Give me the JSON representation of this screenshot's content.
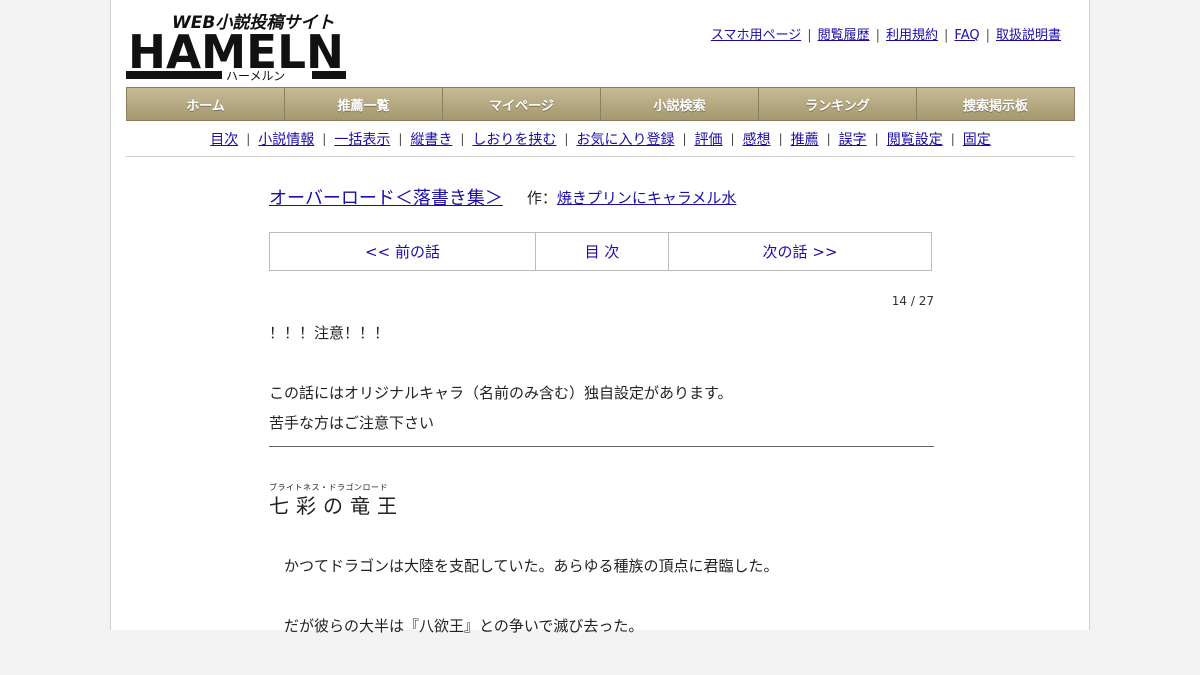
{
  "logo": {
    "tagline": "WEB小説投稿サイト",
    "name": "HAMELN",
    "kana": "ハーメルン"
  },
  "top_links": [
    "スマホ用ページ",
    "閲覧履歴",
    "利用規約",
    "FAQ",
    "取扱説明書"
  ],
  "main_nav": [
    "ホーム",
    "推薦一覧",
    "マイページ",
    "小説検索",
    "ランキング",
    "捜索掲示板"
  ],
  "sub_nav": [
    "目次",
    "小説情報",
    "一括表示",
    "縦書き",
    "しおりを挟む",
    "お気に入り登録",
    "評価",
    "感想",
    "推薦",
    "誤字",
    "閲覧設定",
    "固定"
  ],
  "novel": {
    "title": "オーバーロード＜落書き集＞",
    "author_label": "作：",
    "author": "焼きプリンにキャラメル水"
  },
  "chapter_nav": {
    "prev": "<< 前の話",
    "toc": "目 次",
    "next": "次の話 >>"
  },
  "episode_count": "14 / 27",
  "notice": [
    "！！！注意！！！",
    "",
    "この話にはオリジナルキャラ（名前のみ含む）独自設定があります。",
    "苦手な方はご注意下さい"
  ],
  "chapter": {
    "ruby": "ブライトネス・ドラゴンロード",
    "title": "七彩の竜王"
  },
  "body": [
    "かつてドラゴンは大陸を支配していた。あらゆる種族の頂点に君臨した。",
    "だが彼らの大半は『八欲王』との争いで滅び去った。"
  ]
}
